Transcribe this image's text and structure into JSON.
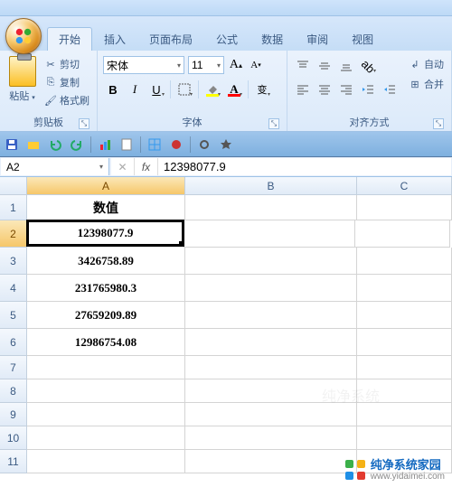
{
  "tabs": [
    "开始",
    "插入",
    "页面布局",
    "公式",
    "数据",
    "审阅",
    "视图"
  ],
  "active_tab_index": 0,
  "clipboard": {
    "paste": "粘贴",
    "cut": "剪切",
    "copy": "复制",
    "format_painter": "格式刷",
    "group_label": "剪贴板"
  },
  "font": {
    "name": "宋体",
    "size": "11",
    "group_label": "字体",
    "bold": "B",
    "italic": "I",
    "underline": "U"
  },
  "alignment": {
    "group_label": "对齐方式",
    "wrap": "自动",
    "merge": "合并"
  },
  "namebox": "A2",
  "formula": "12398077.9",
  "columns": [
    "A",
    "B",
    "C"
  ],
  "header_cell": "数值",
  "rows": [
    "12398077.9",
    "3426758.89",
    "231765980.3",
    "27659209.89",
    "12986754.08"
  ],
  "watermark": {
    "title": "纯净系统家园",
    "url": "www.yidaimei.com"
  }
}
